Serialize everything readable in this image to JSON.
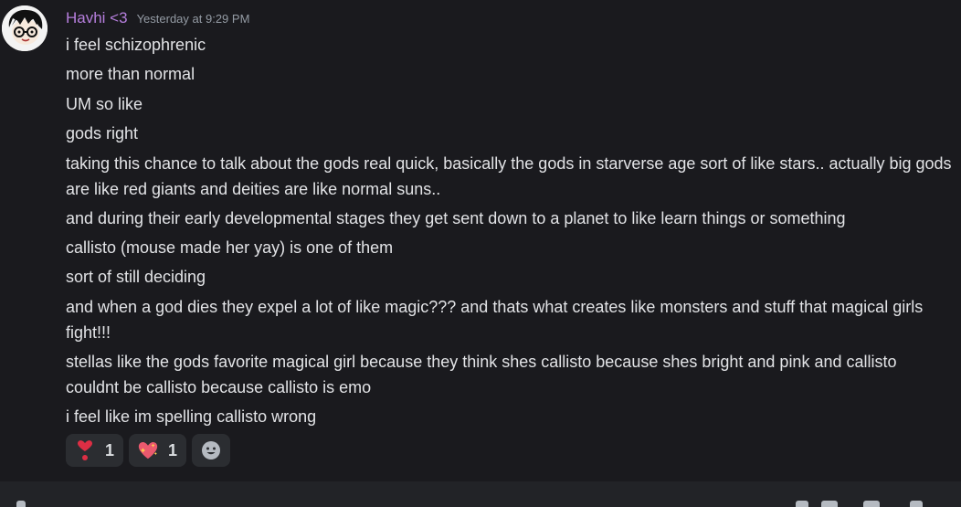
{
  "message": {
    "username": "Havhi <3",
    "timestamp": "Yesterday at 9:29 PM",
    "lines": [
      "i feel schizophrenic",
      "more than normal",
      "UM so like",
      "gods right",
      "taking this chance to talk about the gods real quick, basically the gods in starverse age sort of like stars.. actually big gods are like red giants and deities are like normal suns..",
      "and during their early developmental stages they get sent down to a planet to like learn things or something",
      "callisto (mouse made her yay) is one of them",
      "sort of still deciding",
      "and when a god dies they expel a lot of like magic??? and thats what creates like monsters and stuff that magical girls fight!!!",
      "stellas like the gods favorite magical girl because they think shes callisto because shes bright and pink and callisto couldnt be callisto because callisto is emo",
      "i feel like im spelling callisto wrong"
    ]
  },
  "reactions": [
    {
      "icon": "exclamation-heart-icon",
      "count": "1"
    },
    {
      "icon": "sparkling-heart-icon",
      "count": "1"
    }
  ],
  "add_reaction_icon": "smiley-face-icon",
  "colors": {
    "background": "#1a1a1e",
    "username": "#b57edc",
    "timestamp": "#949ba4",
    "text": "#e2e3e6",
    "reaction_bg": "#2b2d31"
  }
}
